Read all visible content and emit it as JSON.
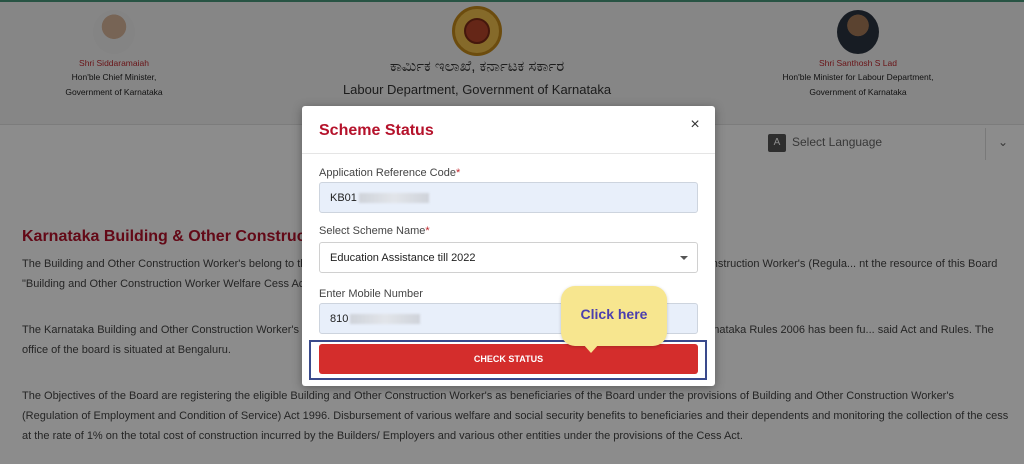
{
  "header": {
    "left_person": {
      "name": "Shri Siddaramaiah",
      "title_line1": "Hon'ble Chief Minister,",
      "title_line2": "Government of Karnataka"
    },
    "right_person": {
      "name": "Shri Santhosh S Lad",
      "title_line1": "Hon'ble Minister for Labour Department,",
      "title_line2": "Government of Karnataka"
    },
    "kannada_title": "ಕಾರ್ಮಿಕ ಇಲಾಖೆ, ಕರ್ನಾಟಕ ಸರ್ಕಾರ",
    "department_title": "Labour Department, Government of Karnataka"
  },
  "language": {
    "label": "Select Language"
  },
  "content": {
    "section_title": "Karnataka Building & Other Construction",
    "paragraphs": [
      "The Building and Other Construction Worker's belong to th... es of these workers, the Central Government has enacted Building and Other Construction Worker's (Regula... nt the resource of this Board \"Building and Other Construction Worker Welfare Cess Act 1996 and Central R...",
      "The Karnataka Building and Other Construction Worker's V... Worker's (Regulation of Employment and Condition of Service) Act 1996 and Karnataka Rules 2006 has been fu... said Act and Rules. The office of the board is situated at Bengaluru.",
      "The Objectives of the Board are registering the eligible Building and Other Construction Worker's as beneficiaries of the Board under the provisions of Building and Other Construction Worker's (Regulation of Employment and Condition of Service) Act 1996. Disbursement of various welfare and social security benefits to beneficiaries and their dependents and monitoring the collection of the cess at the rate of 1% on the total cost of construction incurred by the Builders/ Employers and various other entities under the provisions of the Cess Act."
    ]
  },
  "modal": {
    "title": "Scheme Status",
    "close_symbol": "×",
    "fields": {
      "ref_code_label": "Application Reference Code",
      "ref_code_value": "KB01",
      "scheme_label": "Select Scheme Name",
      "scheme_value": "Education Assistance till 2022",
      "mobile_label": "Enter Mobile Number",
      "mobile_value": "810"
    },
    "required_mark": "*",
    "submit_label": "CHECK STATUS"
  },
  "callout": {
    "text": "Click here"
  },
  "colors": {
    "brand_red": "#b5122b",
    "button_red": "#d42d2c",
    "callout_yellow": "#f7e68f",
    "callout_text": "#4b3fae",
    "highlight_border": "#3a4a8c"
  }
}
